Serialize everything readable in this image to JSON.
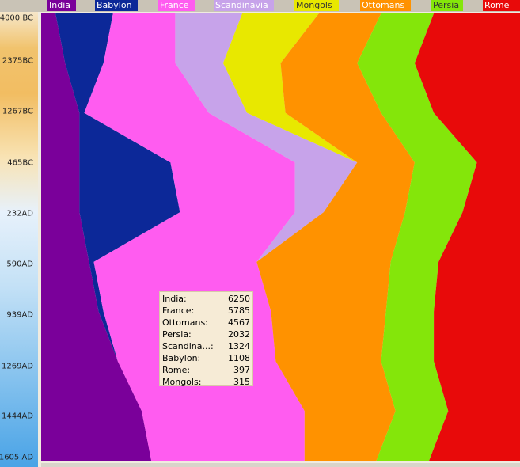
{
  "civilizations": [
    {
      "name": "India",
      "color": "#7a009a"
    },
    {
      "name": "Babylon",
      "color": "#0c2898"
    },
    {
      "name": "France",
      "color": "#ff5cf0"
    },
    {
      "name": "Scandinavia",
      "color": "#c7a3ea"
    },
    {
      "name": "Mongols",
      "color": "#e8e800"
    },
    {
      "name": "Ottomans",
      "color": "#ff9200"
    },
    {
      "name": "Persia",
      "color": "#84e60a"
    },
    {
      "name": "Rome",
      "color": "#e80a0a"
    }
  ],
  "years": [
    "4000 BC",
    "2375BC",
    "1267BC",
    "465BC",
    "232AD",
    "590AD",
    "939AD",
    "1269AD",
    "1444AD",
    "1605 AD"
  ],
  "tooltip": [
    {
      "name": "India:",
      "value": "6250"
    },
    {
      "name": "France:",
      "value": "5785"
    },
    {
      "name": "Ottomans:",
      "value": "4567"
    },
    {
      "name": "Persia:",
      "value": "2032"
    },
    {
      "name": "Scandina...:",
      "value": "1324"
    },
    {
      "name": "Babylon:",
      "value": "1108"
    },
    {
      "name": "Rome:",
      "value": "397"
    },
    {
      "name": "Mongols:",
      "value": "315"
    }
  ],
  "chart_data": {
    "type": "area",
    "x": [
      "4000 BC",
      "2375BC",
      "1267BC",
      "465BC",
      "232AD",
      "590AD",
      "939AD",
      "1269AD",
      "1444AD",
      "1605 AD"
    ],
    "series": [
      {
        "name": "India",
        "values": [
          3,
          5,
          8,
          8,
          8,
          10,
          12,
          16,
          21,
          23
        ]
      },
      {
        "name": "Babylon",
        "values": [
          12,
          8,
          1,
          19,
          21,
          1,
          1,
          0,
          0,
          0
        ]
      },
      {
        "name": "France",
        "values": [
          13,
          15,
          26,
          26,
          24,
          34,
          35,
          33,
          34,
          32
        ]
      },
      {
        "name": "Scandinavia",
        "values": [
          14,
          10,
          8,
          13,
          6,
          0,
          0,
          0,
          0,
          0
        ]
      },
      {
        "name": "Mongols",
        "values": [
          16,
          12,
          8,
          0,
          0,
          0,
          0,
          0,
          0,
          0
        ]
      },
      {
        "name": "Ottomans",
        "values": [
          13,
          16,
          20,
          12,
          17,
          28,
          24,
          22,
          19,
          15
        ]
      },
      {
        "name": "Persia",
        "values": [
          11,
          12,
          11,
          13,
          12,
          10,
          10,
          11,
          11,
          11
        ]
      },
      {
        "name": "Rome",
        "values": [
          18,
          22,
          18,
          19,
          12,
          17,
          18,
          18,
          17,
          19
        ]
      }
    ]
  }
}
